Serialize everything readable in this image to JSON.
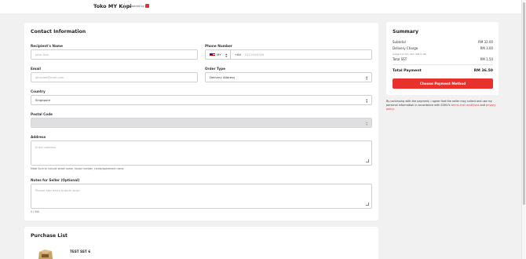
{
  "header": {
    "brand": "Toko MY Kopi",
    "powered_by": "Powered by"
  },
  "contact": {
    "title": "Contact Information",
    "recipient": {
      "label": "Recipient's Name",
      "placeholder": "John Doe"
    },
    "phone": {
      "label": "Phone Number",
      "country": "MY",
      "prefix": "+60",
      "placeholder": "0123456789"
    },
    "email": {
      "label": "Email",
      "placeholder": "johndoe@mail.com"
    },
    "order_type": {
      "label": "Order Type",
      "value": "Delivery Address"
    },
    "country": {
      "label": "Country",
      "value": "Singapore"
    },
    "postal": {
      "label": "Postal Code",
      "value": ""
    },
    "address": {
      "label": "Address",
      "placeholder": "Enter address",
      "hint": "Make Sure to include street name, house number, condo/apartment name"
    },
    "notes": {
      "label": "Notes for Seller (Optional)",
      "placeholder": "Please add extra bubble wrap",
      "counter": "0 / 500"
    }
  },
  "purchase": {
    "title": "Purchase List",
    "items": [
      {
        "name": "TEST SST 6"
      }
    ]
  },
  "summary": {
    "title": "Summary",
    "subtotal_label": "Subtotal",
    "subtotal_value": "RM 32.00",
    "delivery_label": "Delivery Charge",
    "delivery_value": "RM 3.00",
    "delivery_note": "Subject to 6% SST (RM 0.18)",
    "sst_label": "Total SST",
    "sst_value": "RM 1.50",
    "total_label": "Total Payment",
    "total_value": "RM 36.50",
    "button": "Choose Payment Method"
  },
  "consent": {
    "text": "By continuing with the payment, I agree that the seller may collect and use my personal information in accordance with SOKU's",
    "terms": "terms and conditions",
    "and": "and",
    "privacy": "privacy policy",
    "end": "."
  },
  "colors": {
    "accent": "#e8312c",
    "background": "#f1f1f2"
  }
}
